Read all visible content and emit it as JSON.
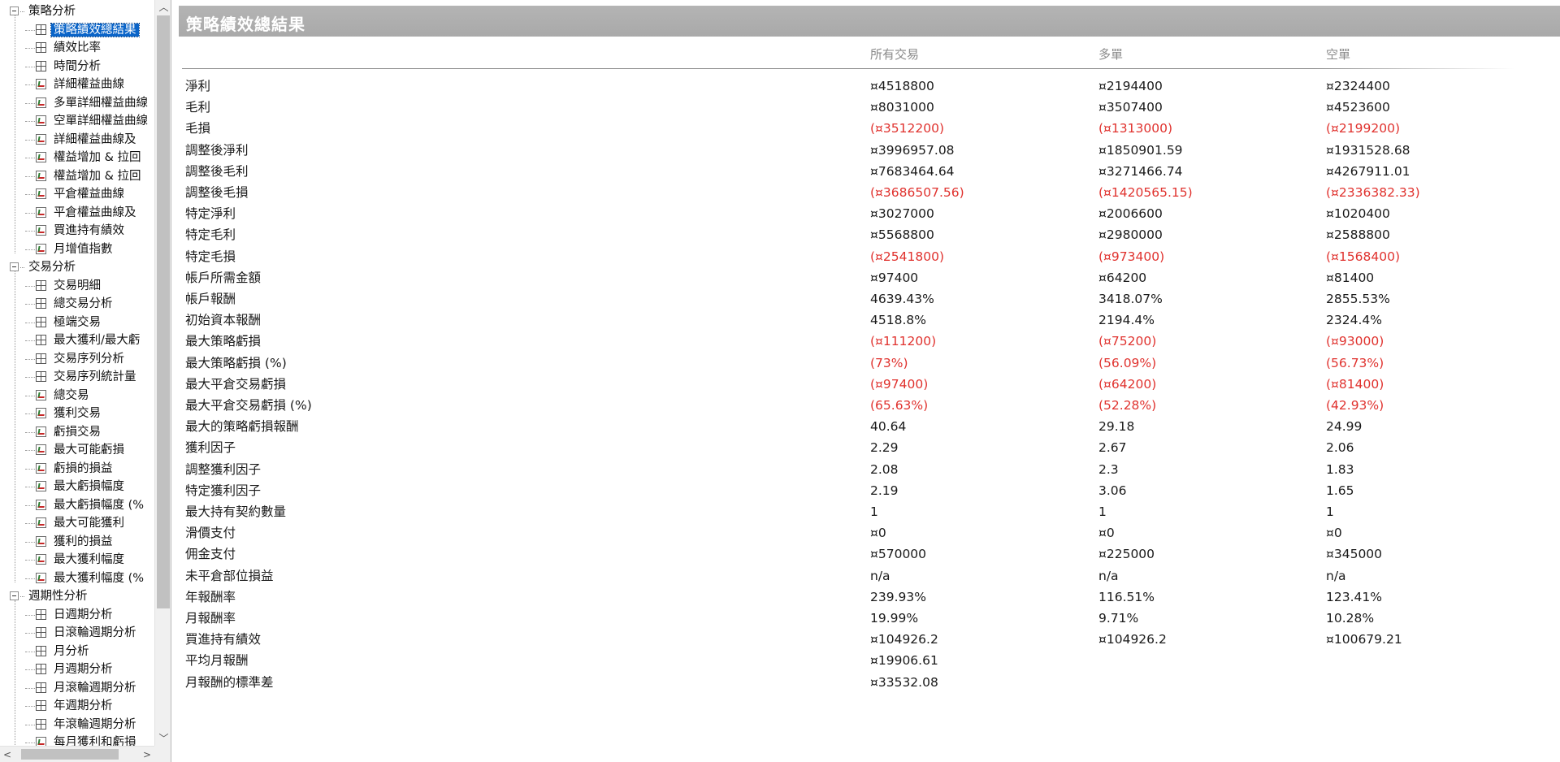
{
  "tree": {
    "groups": [
      {
        "label": "策略分析",
        "items": [
          {
            "label": "策略績效總結果",
            "icon": "table-icon",
            "selected": true
          },
          {
            "label": "績效比率",
            "icon": "table-icon"
          },
          {
            "label": "時間分析",
            "icon": "table-icon"
          },
          {
            "label": "詳細權益曲線",
            "icon": "chart-icon"
          },
          {
            "label": "多單詳細權益曲線",
            "icon": "chart-icon"
          },
          {
            "label": "空單詳細權益曲線",
            "icon": "chart-icon"
          },
          {
            "label": "詳細權益曲線及",
            "icon": "chart-icon"
          },
          {
            "label": "權益增加 & 拉回",
            "icon": "chart-icon"
          },
          {
            "label": "權益增加 & 拉回",
            "icon": "chart-icon"
          },
          {
            "label": "平倉權益曲線",
            "icon": "chart-icon"
          },
          {
            "label": "平倉權益曲線及",
            "icon": "chart-icon"
          },
          {
            "label": "買進持有績效",
            "icon": "chart-icon"
          },
          {
            "label": "月增值指數",
            "icon": "chart-icon"
          }
        ]
      },
      {
        "label": "交易分析",
        "items": [
          {
            "label": "交易明細",
            "icon": "table-icon"
          },
          {
            "label": "總交易分析",
            "icon": "table-icon"
          },
          {
            "label": "極端交易",
            "icon": "table-icon"
          },
          {
            "label": "最大獲利/最大虧",
            "icon": "table-icon"
          },
          {
            "label": "交易序列分析",
            "icon": "table-icon"
          },
          {
            "label": "交易序列統計量",
            "icon": "table-icon"
          },
          {
            "label": "總交易",
            "icon": "chart-icon"
          },
          {
            "label": "獲利交易",
            "icon": "chart-icon"
          },
          {
            "label": "虧損交易",
            "icon": "chart-icon"
          },
          {
            "label": "最大可能虧損",
            "icon": "chart-icon"
          },
          {
            "label": "虧損的損益",
            "icon": "chart-icon"
          },
          {
            "label": "最大虧損幅度",
            "icon": "chart-icon"
          },
          {
            "label": "最大虧損幅度 (%",
            "icon": "chart-icon"
          },
          {
            "label": "最大可能獲利",
            "icon": "chart-icon"
          },
          {
            "label": "獲利的損益",
            "icon": "chart-icon"
          },
          {
            "label": "最大獲利幅度",
            "icon": "chart-icon"
          },
          {
            "label": "最大獲利幅度 (%",
            "icon": "chart-icon"
          }
        ]
      },
      {
        "label": "週期性分析",
        "items": [
          {
            "label": "日週期分析",
            "icon": "table-icon"
          },
          {
            "label": "日滾輪週期分析",
            "icon": "table-icon"
          },
          {
            "label": "月分析",
            "icon": "table-icon"
          },
          {
            "label": "月週期分析",
            "icon": "table-icon"
          },
          {
            "label": "月滾輪週期分析",
            "icon": "table-icon"
          },
          {
            "label": "年週期分析",
            "icon": "table-icon"
          },
          {
            "label": "年滾輪週期分析",
            "icon": "table-icon"
          },
          {
            "label": "每月獲利和虧損",
            "icon": "chart-icon"
          }
        ]
      }
    ]
  },
  "report": {
    "title": "策略績效總結果",
    "columns": [
      "所有交易",
      "多單",
      "空單"
    ],
    "rows": [
      {
        "label": "淨利",
        "values": [
          "¤4518800",
          "¤2194400",
          "¤2324400"
        ],
        "negative": false
      },
      {
        "label": "毛利",
        "values": [
          "¤8031000",
          "¤3507400",
          "¤4523600"
        ],
        "negative": false
      },
      {
        "label": "毛損",
        "values": [
          "(¤3512200)",
          "(¤1313000)",
          "(¤2199200)"
        ],
        "negative": true
      },
      {
        "label": "調整後淨利",
        "values": [
          "¤3996957.08",
          "¤1850901.59",
          "¤1931528.68"
        ],
        "negative": false
      },
      {
        "label": "調整後毛利",
        "values": [
          "¤7683464.64",
          "¤3271466.74",
          "¤4267911.01"
        ],
        "negative": false
      },
      {
        "label": "調整後毛損",
        "values": [
          "(¤3686507.56)",
          "(¤1420565.15)",
          "(¤2336382.33)"
        ],
        "negative": true
      },
      {
        "label": "特定淨利",
        "values": [
          "¤3027000",
          "¤2006600",
          "¤1020400"
        ],
        "negative": false
      },
      {
        "label": "特定毛利",
        "values": [
          "¤5568800",
          "¤2980000",
          "¤2588800"
        ],
        "negative": false
      },
      {
        "label": "特定毛損",
        "values": [
          "(¤2541800)",
          "(¤973400)",
          "(¤1568400)"
        ],
        "negative": true
      },
      {
        "label": "帳戶所需金額",
        "values": [
          "¤97400",
          "¤64200",
          "¤81400"
        ],
        "negative": false
      },
      {
        "label": "帳戶報酬",
        "values": [
          "4639.43%",
          "3418.07%",
          "2855.53%"
        ],
        "negative": false
      },
      {
        "label": "初始資本報酬",
        "values": [
          "4518.8%",
          "2194.4%",
          "2324.4%"
        ],
        "negative": false
      },
      {
        "label": "最大策略虧損",
        "values": [
          "(¤111200)",
          "(¤75200)",
          "(¤93000)"
        ],
        "negative": true
      },
      {
        "label": "最大策略虧損 (%)",
        "values": [
          "(73%)",
          "(56.09%)",
          "(56.73%)"
        ],
        "negative": true
      },
      {
        "label": "最大平倉交易虧損",
        "values": [
          "(¤97400)",
          "(¤64200)",
          "(¤81400)"
        ],
        "negative": true
      },
      {
        "label": "最大平倉交易虧損 (%)",
        "values": [
          "(65.63%)",
          "(52.28%)",
          "(42.93%)"
        ],
        "negative": true
      },
      {
        "label": "最大的策略虧損報酬",
        "values": [
          "40.64",
          "29.18",
          "24.99"
        ],
        "negative": false
      },
      {
        "label": "獲利因子",
        "values": [
          "2.29",
          "2.67",
          "2.06"
        ],
        "negative": false
      },
      {
        "label": "調整獲利因子",
        "values": [
          "2.08",
          "2.3",
          "1.83"
        ],
        "negative": false
      },
      {
        "label": "特定獲利因子",
        "values": [
          "2.19",
          "3.06",
          "1.65"
        ],
        "negative": false
      },
      {
        "label": "最大持有契約數量",
        "values": [
          "1",
          "1",
          "1"
        ],
        "negative": false
      },
      {
        "label": "滑價支付",
        "values": [
          "¤0",
          "¤0",
          "¤0"
        ],
        "negative": false
      },
      {
        "label": "佣金支付",
        "values": [
          "¤570000",
          "¤225000",
          "¤345000"
        ],
        "negative": false
      },
      {
        "label": "未平倉部位損益",
        "values": [
          "n/a",
          "n/a",
          "n/a"
        ],
        "negative": false
      },
      {
        "label": "年報酬率",
        "values": [
          "239.93%",
          "116.51%",
          "123.41%"
        ],
        "negative": false
      },
      {
        "label": "月報酬率",
        "values": [
          "19.99%",
          "9.71%",
          "10.28%"
        ],
        "negative": false
      },
      {
        "label": "買進持有績效",
        "values": [
          "¤104926.2",
          "¤104926.2",
          "¤100679.21"
        ],
        "negative": false
      },
      {
        "label": "平均月報酬",
        "values": [
          "¤19906.61",
          "",
          ""
        ],
        "negative": false
      },
      {
        "label": "月報酬的標準差",
        "values": [
          "¤33532.08",
          "",
          ""
        ],
        "negative": false
      }
    ]
  },
  "colors": {
    "negative": "#e0322e",
    "selection": "#0a64c8",
    "title_bar": "#aeaeae"
  }
}
